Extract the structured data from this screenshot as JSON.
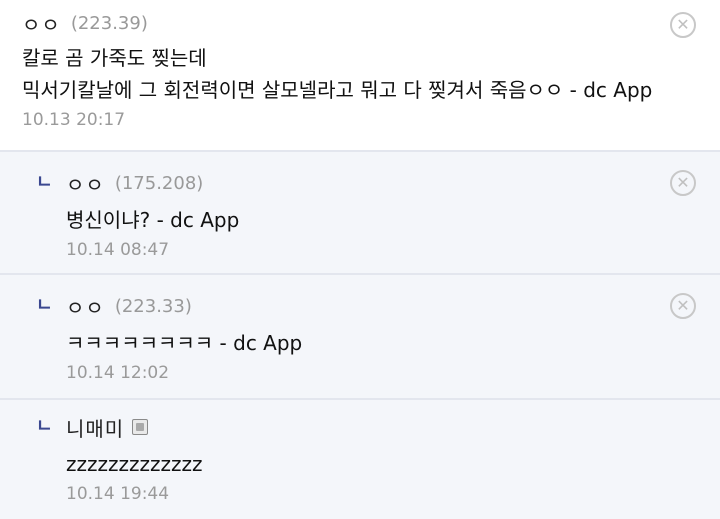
{
  "comments": [
    {
      "nick": "ㅇㅇ",
      "ip": "(223.39)",
      "lines": [
        "칼로 곰 가죽도 찢는데",
        "믹서기칼날에 그 회전력이면 살모넬라고 뭐고 다 찢겨서 죽음ㅇㅇ - dc App"
      ],
      "date": "10.13 20:17",
      "reply_marker": ""
    },
    {
      "nick": "ㅇㅇ",
      "ip": "(175.208)",
      "lines": [
        "병신이냐? - dc App"
      ],
      "date": "10.14 08:47",
      "reply_marker": "ㄴ"
    },
    {
      "nick": "ㅇㅇ",
      "ip": "(223.33)",
      "lines": [
        "ㅋㅋㅋㅋㅋㅋㅋㅋ - dc App"
      ],
      "date": "10.14 12:02",
      "reply_marker": "ㄴ"
    },
    {
      "nick": "니매미",
      "ip": "",
      "lines": [
        "zzzzzzzzzzzzz"
      ],
      "date": "10.14 19:44",
      "reply_marker": "ㄴ"
    }
  ],
  "icons": {
    "delete": "close-circle-icon",
    "reply": "reply-arrow-icon",
    "fixed_nick": "gallery-nick-icon"
  },
  "colors": {
    "reply_marker": "#3b4890",
    "reply_bg": "#f4f6fa",
    "meta_text": "#999999"
  }
}
